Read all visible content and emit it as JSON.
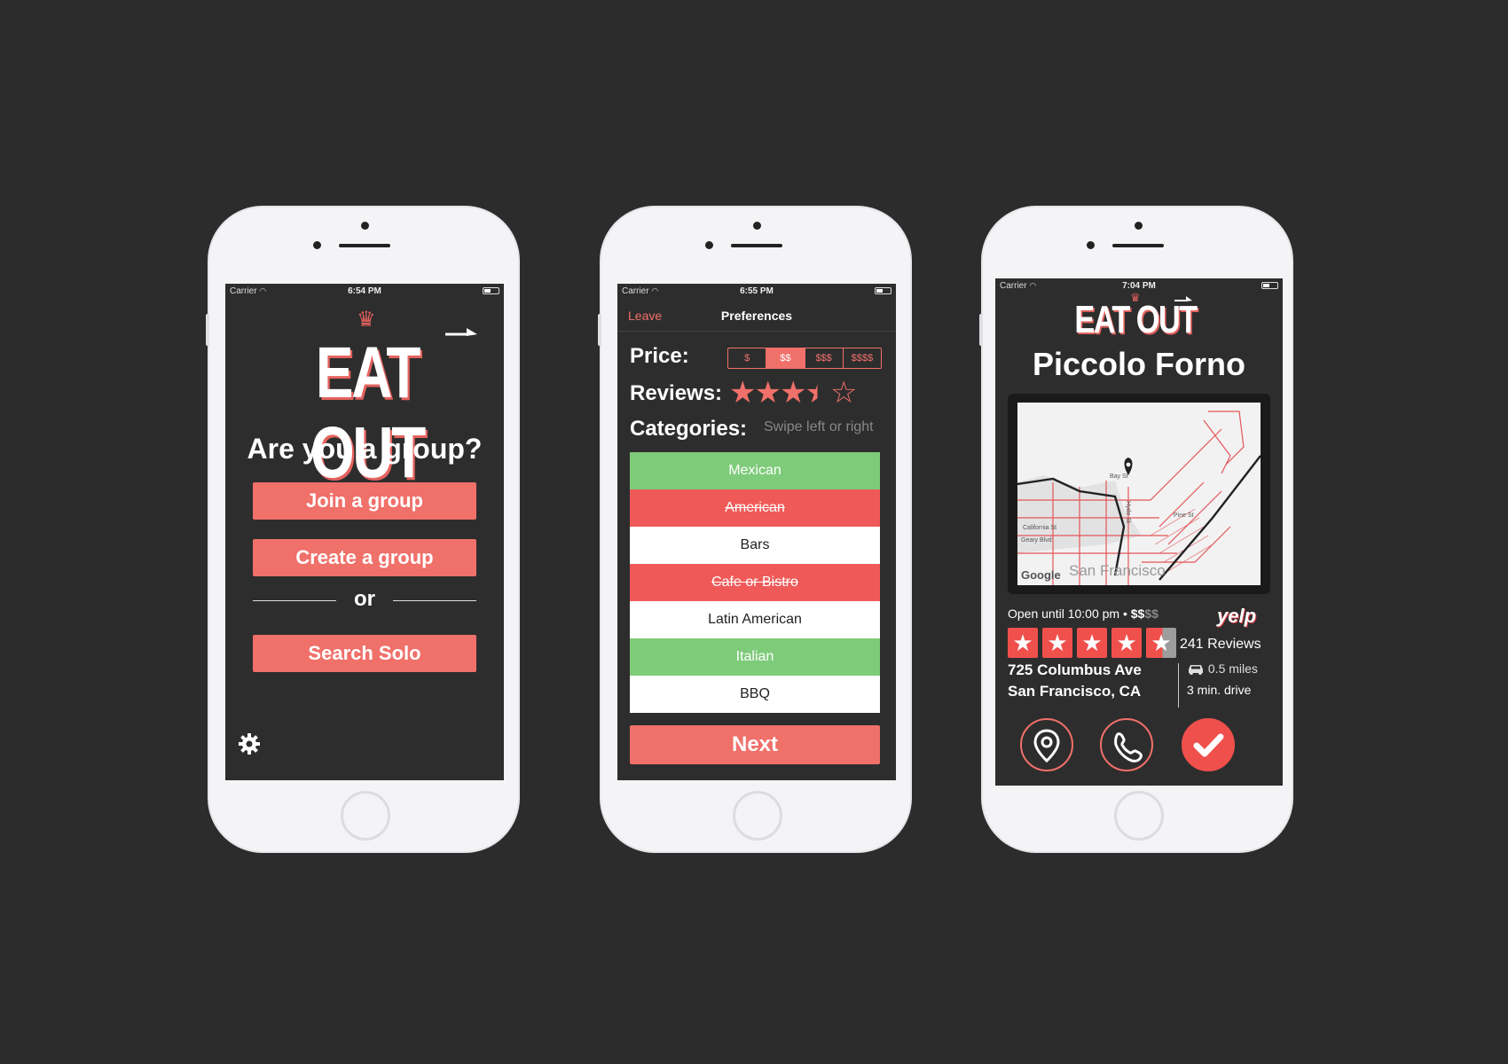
{
  "status": {
    "carrier": "Carrier",
    "screen1_time": "6:54 PM",
    "screen2_time": "6:55 PM",
    "screen3_time": "7:04 PM"
  },
  "brand": {
    "logo_text": "EAT OUT",
    "accent": "#f0706a"
  },
  "screen1": {
    "question": "Are you a group?",
    "join_label": "Join a group",
    "create_label": "Create a group",
    "or_label": "or",
    "solo_label": "Search Solo",
    "settings_icon": "gear-icon"
  },
  "screen2": {
    "leave_label": "Leave",
    "title": "Preferences",
    "price_label": "Price:",
    "price_options": [
      "$",
      "$$",
      "$$$",
      "$$$$"
    ],
    "price_selected": "$$",
    "reviews_label": "Reviews:",
    "reviews_rating": 3.5,
    "categories_label": "Categories:",
    "categories_hint": "Swipe left or right",
    "categories": [
      {
        "name": "Mexican",
        "state": "like"
      },
      {
        "name": "American",
        "state": "dislike"
      },
      {
        "name": "Bars",
        "state": "neutral"
      },
      {
        "name": "Cafe or Bistro",
        "state": "dislike"
      },
      {
        "name": "Latin American",
        "state": "neutral"
      },
      {
        "name": "Italian",
        "state": "like"
      },
      {
        "name": "BBQ",
        "state": "neutral"
      }
    ],
    "next_label": "Next"
  },
  "screen3": {
    "restaurant_name": "Piccolo Forno",
    "map_attribution": "Google",
    "map_city": "San Francisco",
    "map_streets": [
      "Bay St",
      "Pine St",
      "California St",
      "Geary Blvd",
      "Hyde St"
    ],
    "open_text": "Open until 10:00 pm •",
    "price_active": "$$",
    "price_inactive": "$$",
    "yelp_label": "yelp",
    "yelp_rating": 4.5,
    "reviews_text": "241 Reviews",
    "address_line1": "725 Columbus Ave",
    "address_line2": "San Francisco, CA",
    "distance": "0.5 miles",
    "drive_time": "3 min. drive",
    "action_icons": [
      "location-pin-icon",
      "phone-icon",
      "checkmark-icon"
    ]
  }
}
